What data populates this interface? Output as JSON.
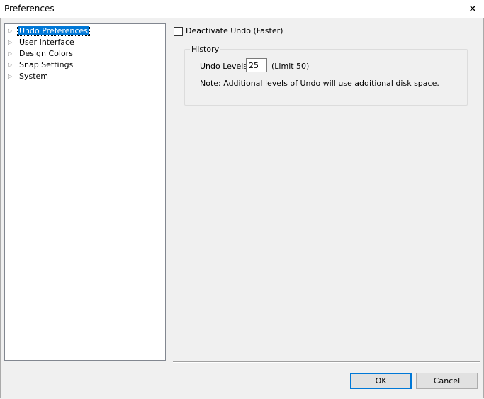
{
  "window": {
    "title": "Preferences",
    "close_glyph": "✕"
  },
  "tree": {
    "items": [
      {
        "label": "Undo Preferences",
        "selected": true
      },
      {
        "label": "User Interface"
      },
      {
        "label": "Design Colors"
      },
      {
        "label": "Snap Settings"
      },
      {
        "label": "System"
      }
    ],
    "expander_glyph": "▷"
  },
  "undo": {
    "deactivate_label": "Deactivate Undo (Faster)",
    "deactivate_checked": false,
    "history_title": "History",
    "levels_label": "Undo Levels:",
    "levels_value": "25",
    "limit_text": "(Limit 50)",
    "note": "Note:  Additional levels of Undo will use additional disk space."
  },
  "buttons": {
    "ok": "OK",
    "cancel": "Cancel"
  },
  "colors": {
    "selection": "#0078d7",
    "button_face": "#e1e1e1"
  }
}
